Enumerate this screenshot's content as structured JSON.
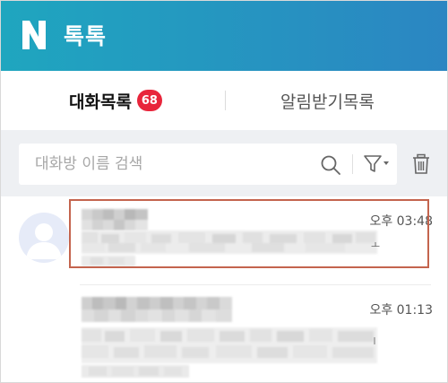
{
  "header": {
    "logo_letter": "N",
    "title": "톡톡",
    "colors": {
      "gradient_start": "#1fa6bf",
      "gradient_end": "#2b86c2"
    }
  },
  "tabs": [
    {
      "label": "대화목록",
      "badge": "68",
      "active": true
    },
    {
      "label": "알림받기목록",
      "active": false
    }
  ],
  "search": {
    "placeholder": "대화방 이름 검색",
    "value": "",
    "icons": [
      "search-icon",
      "filter-icon",
      "trash-icon"
    ]
  },
  "conversations": [
    {
      "time": "오후 03:48",
      "name": "",
      "preview": "",
      "trailing": "ㅗ",
      "highlighted": true,
      "avatar": "default-profile-icon"
    },
    {
      "time": "오후 01:13",
      "name": "",
      "preview": "",
      "trailing": "",
      "highlighted": false,
      "avatar": ""
    }
  ],
  "colors": {
    "badge": "#e8253b",
    "highlight_border": "#c4644e",
    "search_bg": "#eef0f3",
    "avatar_bg": "#e6ebf8"
  }
}
